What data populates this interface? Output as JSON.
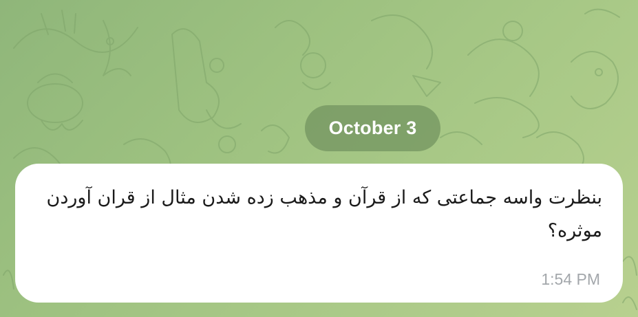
{
  "chat": {
    "date_separator": "October 3",
    "message": {
      "text": "بنظرت واسه جماعتی که از قرآن و مذهب زده شدن مثال از قران آوردن موثره؟",
      "time": "1:54 PM"
    }
  },
  "colors": {
    "wallpaper": "#a3c483",
    "bubble": "#ffffff",
    "date_pill": "#7a9b68",
    "timestamp": "#a3a7ab"
  }
}
